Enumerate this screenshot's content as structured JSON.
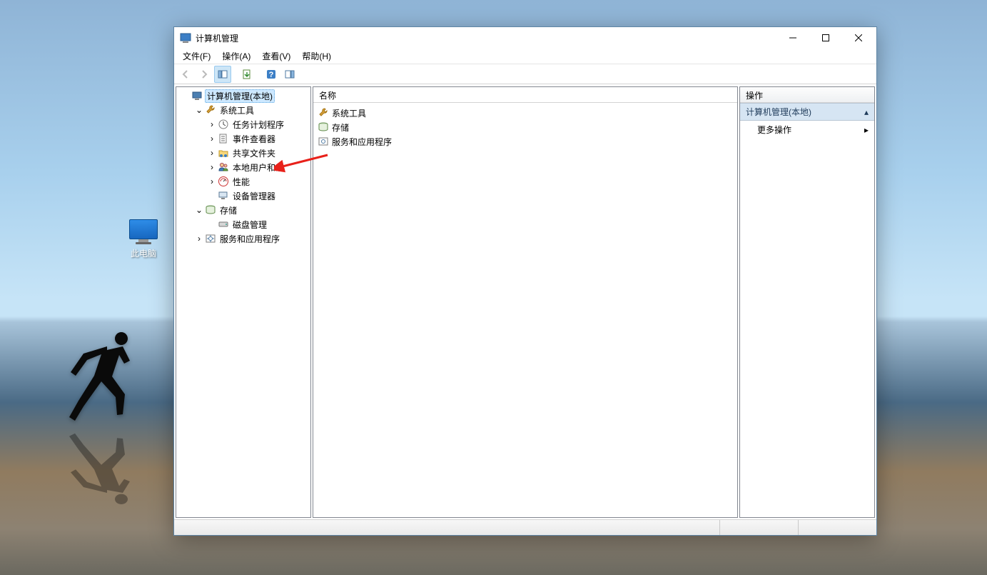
{
  "desktop": {
    "this_pc_label": "此电脑"
  },
  "window": {
    "title": "计算机管理",
    "menu": {
      "file": "文件(F)",
      "action": "操作(A)",
      "view": "查看(V)",
      "help": "帮助(H)"
    }
  },
  "tree": {
    "root": "计算机管理(本地)",
    "system_tools": "系统工具",
    "task_scheduler": "任务计划程序",
    "event_viewer": "事件查看器",
    "shared_folders": "共享文件夹",
    "local_users_groups": "本地用户和组",
    "performance": "性能",
    "device_manager": "设备管理器",
    "storage": "存储",
    "disk_management": "磁盘管理",
    "services_apps": "服务和应用程序"
  },
  "center": {
    "column_name": "名称",
    "items": {
      "system_tools": "系统工具",
      "storage": "存储",
      "services_apps": "服务和应用程序"
    }
  },
  "actions": {
    "header": "操作",
    "section": "计算机管理(本地)",
    "more_actions": "更多操作"
  }
}
